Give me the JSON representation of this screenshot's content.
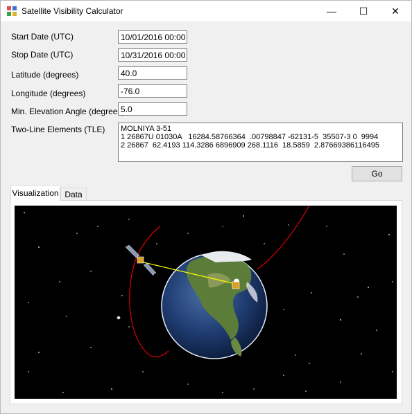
{
  "window": {
    "title": "Satellite Visibility Calculator"
  },
  "titlebar_buttons": {
    "minimize": "—",
    "maximize": "☐",
    "close": "✕"
  },
  "form": {
    "start_date": {
      "label": "Start Date (UTC)",
      "value": "10/01/2016 00:00"
    },
    "stop_date": {
      "label": "Stop Date (UTC)",
      "value": "10/31/2016 00:00"
    },
    "latitude": {
      "label": "Latitude (degrees)",
      "value": "40.0"
    },
    "longitude": {
      "label": "Longitude (degrees)",
      "value": "-76.0"
    },
    "min_elevation": {
      "label": "Min. Elevation Angle (degrees)",
      "value": "5.0"
    },
    "tle": {
      "label": "Two-Line Elements (TLE)",
      "value": "MOLNIYA 3-51\n1 26867U 01030A   16284.58766364  .00798847 -62131-5  35507-3 0  9994\n2 26867  62.4193 114.3286 6896909 268.1116  18.5859  2.87669386116495"
    },
    "go_label": "Go"
  },
  "tabs": [
    {
      "label": "Visualization",
      "active": true
    },
    {
      "label": "Data",
      "active": false
    }
  ],
  "visualization": {
    "orbit_color": "#e00000",
    "line_of_sight_color": "#ffff00",
    "icons": [
      "satellite-icon",
      "ground-station-icon",
      "earth-globe",
      "moon-icon"
    ]
  }
}
